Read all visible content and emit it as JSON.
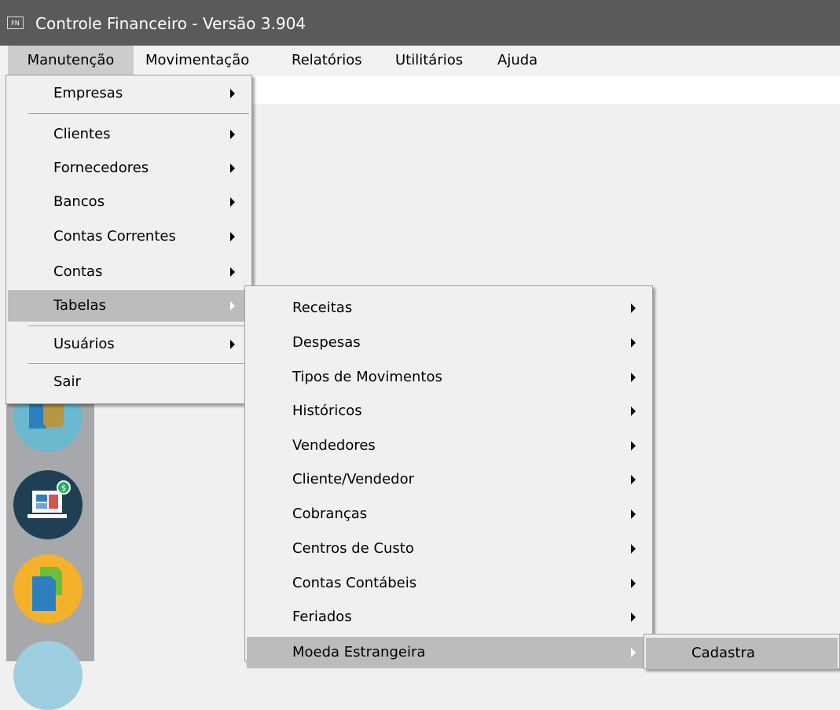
{
  "window": {
    "title": "Controle Financeiro - Versão 3.904",
    "app_icon_text": "FN"
  },
  "menubar": {
    "items": [
      "Manutenção",
      "Movimentação",
      "Relatórios",
      "Utilitários",
      "Ajuda"
    ],
    "active": "Manutenção"
  },
  "manutencao_menu": {
    "items": [
      {
        "label": "Empresas",
        "submenu": true
      },
      {
        "label": "Clientes",
        "submenu": true
      },
      {
        "label": "Fornecedores",
        "submenu": true
      },
      {
        "label": "Bancos",
        "submenu": true
      },
      {
        "label": "Contas Correntes",
        "submenu": true
      },
      {
        "label": "Contas",
        "submenu": true
      },
      {
        "label": "Tabelas",
        "submenu": true,
        "highlighted": true
      },
      {
        "label": "Usuários",
        "submenu": true
      },
      {
        "label": "Sair",
        "submenu": false
      }
    ]
  },
  "tabelas_menu": {
    "items": [
      {
        "label": "Receitas",
        "submenu": true
      },
      {
        "label": "Despesas",
        "submenu": true
      },
      {
        "label": "Tipos de Movimentos",
        "submenu": true
      },
      {
        "label": "Históricos",
        "submenu": true
      },
      {
        "label": "Vendedores",
        "submenu": true
      },
      {
        "label": "Cliente/Vendedor",
        "submenu": true
      },
      {
        "label": "Cobranças",
        "submenu": true
      },
      {
        "label": "Centros de Custo",
        "submenu": true
      },
      {
        "label": "Contas Contábeis",
        "submenu": true
      },
      {
        "label": "Feriados",
        "submenu": true
      },
      {
        "label": "Moeda Estrangeira",
        "submenu": true,
        "highlighted": true
      }
    ]
  },
  "moeda_menu": {
    "items": [
      {
        "label": "Cadastra",
        "highlighted": true
      }
    ]
  },
  "side_icons": [
    "hands-money-icon",
    "laptop-money-icon",
    "documents-icon",
    "circle-icon"
  ],
  "colors": {
    "titlebar": "#5a5a5a",
    "menu_bg": "#f0f0f0",
    "highlight": "#bcbcbc",
    "side_strip": "#a6a8ab"
  }
}
